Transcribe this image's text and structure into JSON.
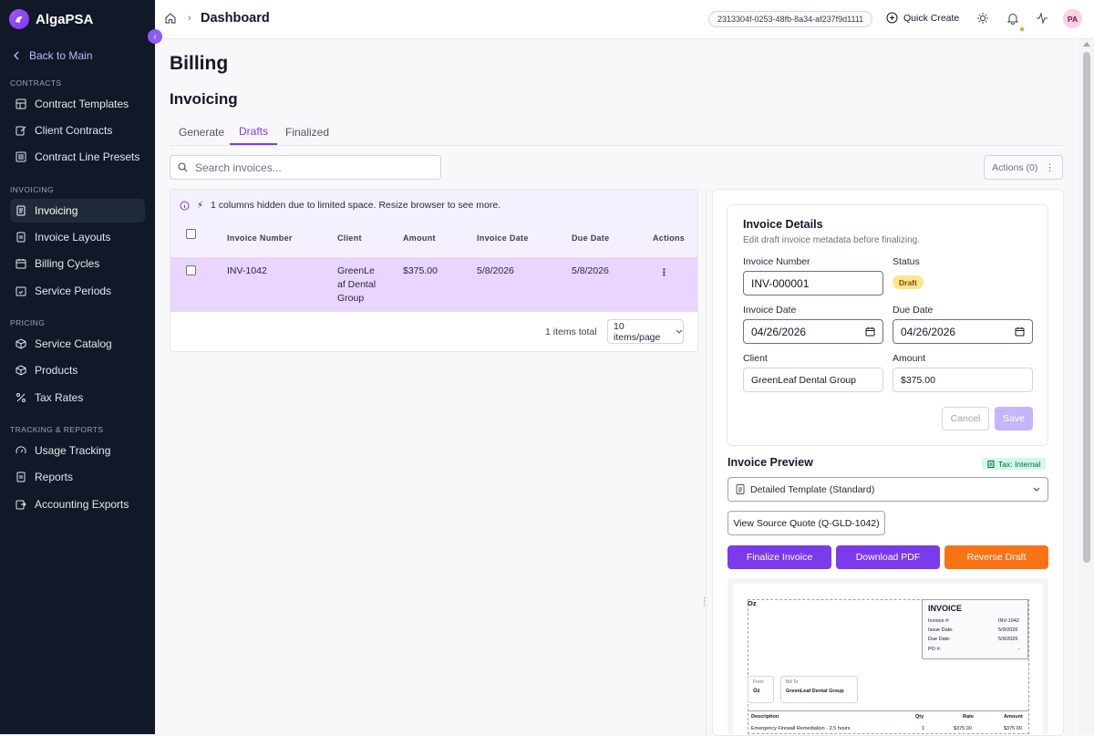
{
  "sidebar": {
    "brand": "AlgaPSA",
    "back_label": "Back to Main",
    "sections": [
      {
        "label": "CONTRACTS",
        "items": [
          {
            "label": "Contract Templates",
            "icon": "layout-icon"
          },
          {
            "label": "Client Contracts",
            "icon": "edit-doc-icon"
          },
          {
            "label": "Contract Line Presets",
            "icon": "layers-icon"
          }
        ]
      },
      {
        "label": "INVOICING",
        "items": [
          {
            "label": "Invoicing",
            "icon": "invoice-icon",
            "active": true
          },
          {
            "label": "Invoice Layouts",
            "icon": "file-text-icon"
          },
          {
            "label": "Billing Cycles",
            "icon": "calendar-icon"
          },
          {
            "label": "Service Periods",
            "icon": "calendar-check-icon"
          }
        ]
      },
      {
        "label": "PRICING",
        "items": [
          {
            "label": "Service Catalog",
            "icon": "package-icon"
          },
          {
            "label": "Products",
            "icon": "box-icon"
          },
          {
            "label": "Tax Rates",
            "icon": "percent-icon"
          }
        ]
      },
      {
        "label": "TRACKING & REPORTS",
        "items": [
          {
            "label": "Usage Tracking",
            "icon": "gauge-icon"
          },
          {
            "label": "Reports",
            "icon": "report-icon"
          },
          {
            "label": "Accounting Exports",
            "icon": "export-icon"
          }
        ]
      }
    ]
  },
  "topbar": {
    "breadcrumb": "Dashboard",
    "tenant_id": "2313304f-0253-48fb-8a34-af237f9d1111",
    "quick_create": "Quick Create",
    "avatar": "PA"
  },
  "main": {
    "page_title": "Billing",
    "section_title": "Invoicing",
    "tabs": [
      {
        "label": "Generate"
      },
      {
        "label": "Drafts",
        "active": true
      },
      {
        "label": "Finalized"
      }
    ],
    "search_placeholder": "Search invoices...",
    "actions_label": "Actions (0)"
  },
  "table": {
    "notice": "1 columns hidden due to limited space. Resize browser to see more.",
    "columns": [
      "Invoice Number",
      "Client",
      "Amount",
      "Invoice Date",
      "Due Date",
      "Actions"
    ],
    "rows": [
      {
        "invoice_number": "INV-1042",
        "client_lines": [
          "GreenLe",
          "af Dental",
          "Group"
        ],
        "amount": "$375.00",
        "invoice_date": "5/8/2026",
        "due_date": "5/8/2026"
      }
    ],
    "items_total": "1 items total",
    "per_page": "10 items/page"
  },
  "details": {
    "title": "Invoice Details",
    "subtitle": "Edit draft invoice metadata before finalizing.",
    "invoice_number_label": "Invoice Number",
    "invoice_number": "INV-000001",
    "status_label": "Status",
    "status": "Draft",
    "invoice_date_label": "Invoice Date",
    "invoice_date": "04/26/2026",
    "due_date_label": "Due Date",
    "due_date": "04/26/2026",
    "client_label": "Client",
    "client": "GreenLeaf Dental Group",
    "amount_label": "Amount",
    "amount": "$375.00",
    "cancel": "Cancel",
    "save": "Save"
  },
  "preview": {
    "title": "Invoice Preview",
    "tax_badge": "Tax: Internal",
    "template": "Detailed Template (Standard)",
    "view_source": "View Source Quote (Q-GLD-1042)",
    "finalize": "Finalize Invoice",
    "download": "Download PDF",
    "reverse": "Reverse Draft",
    "colors": {
      "finalize": "#7c3aed",
      "download": "#7c3aed",
      "reverse": "#f97316"
    },
    "doc": {
      "company": "Oz",
      "heading": "INVOICE",
      "meta": [
        {
          "label": "Invoice #:",
          "value": "INV-1042"
        },
        {
          "label": "Issue Date:",
          "value": "5/9/2026"
        },
        {
          "label": "Due Date:",
          "value": "5/9/2026"
        },
        {
          "label": "PO #:",
          "value": "-"
        }
      ],
      "from_label": "From",
      "from_value": "Oz",
      "bill_to_label": "Bill To",
      "bill_to_value": "GreenLeaf Dental Group",
      "line_headers": [
        "Description",
        "Qty",
        "Rate",
        "Amount"
      ],
      "line_items": [
        {
          "description": "Emergency Firewall Remediation - 2.5 hours",
          "qty": "1",
          "rate": "$375.00",
          "amount": "$375.00"
        }
      ]
    }
  }
}
